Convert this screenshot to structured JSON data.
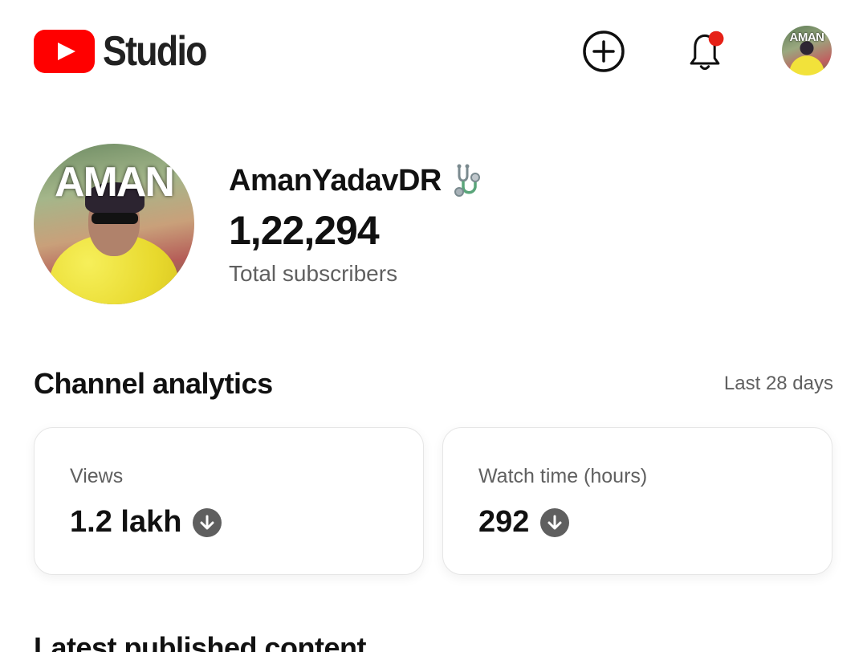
{
  "header": {
    "logo_text": "Studio",
    "brand_color": "#ff0000",
    "icons": [
      "youtube-logo-icon",
      "create-plus-icon",
      "bell-icon",
      "avatar"
    ],
    "notification_dot_color": "#e62117",
    "avatar_label": "AMAN"
  },
  "channel": {
    "name": "AmanYadavDR",
    "name_emoji_icon": "stethoscope-icon",
    "avatar_label": "AMAN",
    "subscriber_count": "1,22,294",
    "subscriber_label": "Total subscribers"
  },
  "analytics": {
    "title": "Channel analytics",
    "range": "Last 28 days",
    "cards": [
      {
        "label": "Views",
        "value": "1.2 lakh",
        "trend": "down"
      },
      {
        "label": "Watch time (hours)",
        "value": "292",
        "trend": "down"
      }
    ]
  },
  "latest": {
    "title": "Latest published content"
  }
}
